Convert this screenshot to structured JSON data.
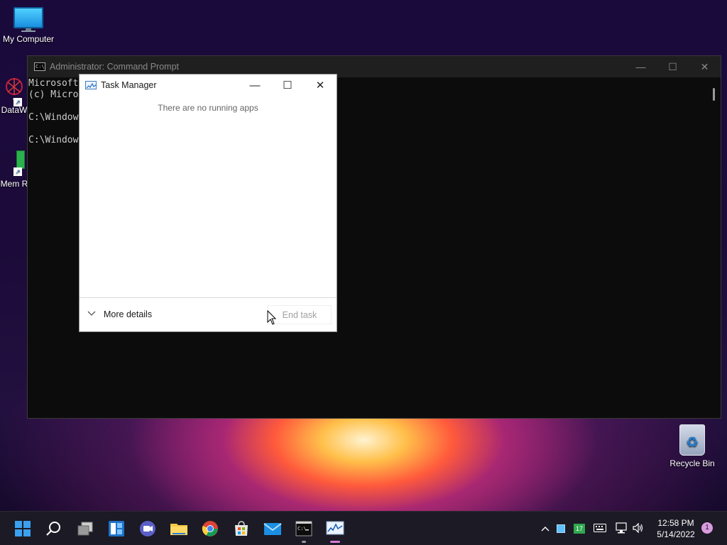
{
  "desktop": {
    "icons": [
      {
        "label": "My Computer"
      },
      {
        "label": "DataW"
      },
      {
        "label": "Mem R"
      },
      {
        "label": "Recycle Bin"
      }
    ]
  },
  "cmd_window": {
    "title": "Administrator: Command Prompt",
    "lines": [
      "Microsoft",
      "(c) Micro",
      "",
      "C:\\Window",
      "",
      "C:\\Window"
    ],
    "controls": {
      "minimize": "—",
      "maximize": "☐",
      "close": "✕"
    }
  },
  "task_manager": {
    "title": "Task Manager",
    "empty_message": "There are no running apps",
    "more_details_label": "More details",
    "end_task_label": "End task",
    "controls": {
      "minimize": "—",
      "maximize": "☐",
      "close": "✕"
    }
  },
  "taskbar": {
    "apps": [
      {
        "name": "start-icon"
      },
      {
        "name": "search-icon"
      },
      {
        "name": "task-view-icon"
      },
      {
        "name": "widgets-icon"
      },
      {
        "name": "teams-chat-icon"
      },
      {
        "name": "file-explorer-icon"
      },
      {
        "name": "chrome-icon"
      },
      {
        "name": "store-icon"
      },
      {
        "name": "mail-icon"
      },
      {
        "name": "command-prompt-icon"
      },
      {
        "name": "task-manager-icon"
      }
    ],
    "tray": {
      "tray_badge": "17",
      "time": "12:58 PM",
      "date": "5/14/2022",
      "notification_count": "1"
    }
  },
  "colors": {
    "accent": "#0078d4",
    "active_indicator": "#d77bd6"
  }
}
